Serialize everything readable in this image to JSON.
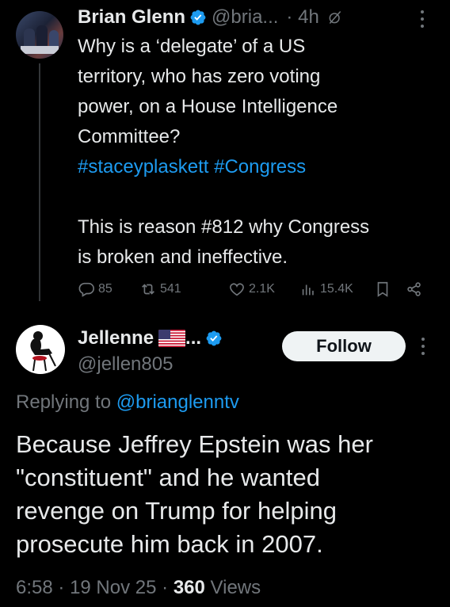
{
  "tweet": {
    "author_name": "Brian Glenn",
    "author_handle": "@bria...",
    "separator": "·",
    "time": "4h",
    "lines": [
      "Why is a ‘delegate’ of a US",
      "territory, who has zero voting",
      "power, on a House Intelligence",
      "Committee?"
    ],
    "hashtags": "#staceyplaskett #Congress",
    "lines2": [
      "This is reason #812 why Congress",
      "is broken and ineffective."
    ],
    "replies": "85",
    "reposts": "541",
    "likes": "2.1K",
    "views": "15.4K",
    "icons": [
      "verified-icon",
      "grok-icon",
      "more-icon",
      "reply-icon",
      "repost-icon",
      "like-icon",
      "views-icon",
      "bookmark-icon",
      "share-icon"
    ]
  },
  "reply": {
    "author_name": "Jellenne",
    "name_ellipsis": "...",
    "author_handle": "@jellen805",
    "follow_label": "Follow",
    "replying_prefix": "Replying to",
    "replying_handle": "@brianglenntv",
    "lines": [
      "Because Jeffrey Epstein was her",
      "\"constituent\" and he wanted",
      "revenge on Trump for helping",
      "prosecute him back in 2007."
    ],
    "time": "6:58",
    "sep": "·",
    "date": "19 Nov 25",
    "views_count": "360",
    "views_label": "Views"
  },
  "colors": {
    "background": "#000000",
    "text": "#e7e9ea",
    "muted": "#71767b",
    "accent": "#1d9bf0"
  }
}
